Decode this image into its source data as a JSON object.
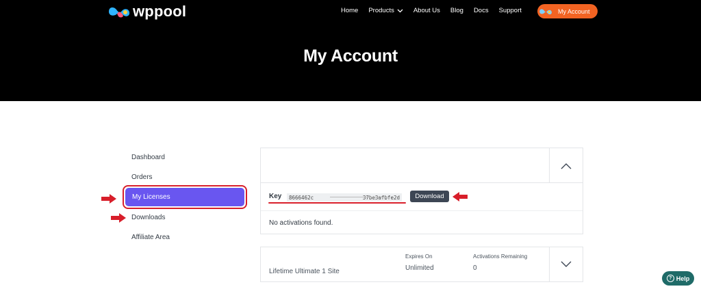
{
  "header": {
    "logo_text": "wppool",
    "nav": [
      {
        "label": "Home",
        "has_dropdown": false
      },
      {
        "label": "Products",
        "has_dropdown": true
      },
      {
        "label": "About Us",
        "has_dropdown": false
      },
      {
        "label": "Blog",
        "has_dropdown": false
      },
      {
        "label": "Docs",
        "has_dropdown": false
      },
      {
        "label": "Support",
        "has_dropdown": false
      }
    ],
    "account_button": "My Account",
    "page_title": "My Account"
  },
  "sidebar": {
    "items": [
      {
        "label": "Dashboard"
      },
      {
        "label": "Orders"
      },
      {
        "label": "My Licenses",
        "active": true
      },
      {
        "label": "Downloads"
      },
      {
        "label": "Affiliate Area"
      }
    ]
  },
  "license": {
    "key_label": "Key",
    "key_start": "8666462c",
    "key_end": "37be3afbfe2d",
    "download_label": "Download",
    "no_activations": "No activations found."
  },
  "product": {
    "name": "Lifetime Ultimate 1 Site",
    "expires_header": "Expires On",
    "expires_value": "Unlimited",
    "activations_header": "Activations Remaining",
    "activations_value": "0"
  },
  "help_label": "Help",
  "colors": {
    "brand_orange": "#f26322",
    "active_purple": "#6956f0",
    "annotation_red": "#d81e2a",
    "help_teal": "#1f6b68"
  }
}
